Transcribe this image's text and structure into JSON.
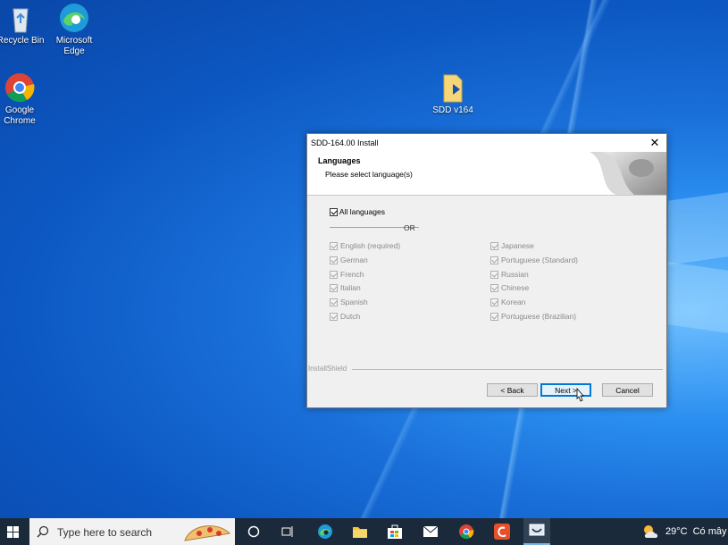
{
  "desktop": {
    "icons": [
      {
        "label": "Recycle Bin"
      },
      {
        "label": "Microsoft Edge"
      },
      {
        "label": "Google Chrome"
      },
      {
        "label": "SDD v164"
      }
    ]
  },
  "dialog": {
    "title": "SDD-164.00 Install",
    "close_glyph": "✕",
    "header_title": "Languages",
    "header_subtitle": "Please select language(s)",
    "all_languages_label": "All languages",
    "or_label": "OR",
    "languages_left": [
      "English (required)",
      "German",
      "French",
      "Italian",
      "Spanish",
      "Dutch"
    ],
    "languages_right": [
      "Japanese",
      "Portuguese (Standard)",
      "Russian",
      "Chinese",
      "Korean",
      "Portuguese (Brazilian)"
    ],
    "footer_brand": "InstallShield",
    "back_label": "< Back",
    "next_label": "Next >",
    "cancel_label": "Cancel"
  },
  "taskbar": {
    "search_placeholder": "Type here to search",
    "weather_temp": "29°C",
    "weather_text": "Có mây"
  },
  "colors": {
    "accent": "#0078d7",
    "taskbar": "#1b2a3a"
  }
}
